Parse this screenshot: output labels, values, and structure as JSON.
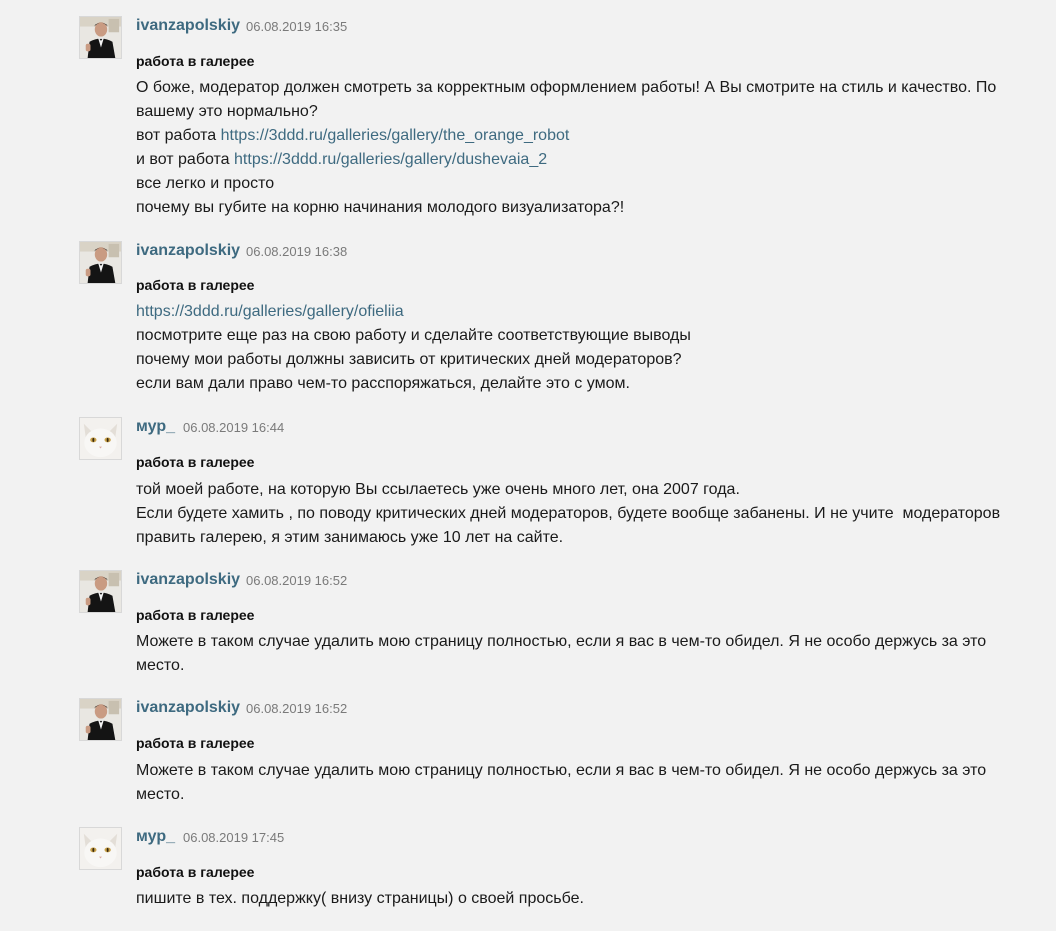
{
  "comments": [
    {
      "author": "ivanzapolskiy",
      "date": "06.08.2019 16:35",
      "subject": "работа в галерее",
      "avatar": "man-in-suit-avatar",
      "lines": [
        {
          "text": "О боже, модератор должен смотреть за корректным оформлением работы! А Вы смотрите на стиль и качество. По"
        },
        {
          "text": "вашему это нормально?"
        },
        {
          "text": "вот работа ",
          "link": "https://3ddd.ru/galleries/gallery/the_orange_robot"
        },
        {
          "text": "и вот работа ",
          "link": "https://3ddd.ru/galleries/gallery/dushevaia_2"
        },
        {
          "text": "все легко и просто"
        },
        {
          "text": "почему вы губите на корню начинания молодого визуализатора?!"
        }
      ]
    },
    {
      "author": "ivanzapolskiy",
      "date": "06.08.2019 16:38",
      "subject": "работа в галерее",
      "avatar": "man-in-suit-avatar",
      "lines": [
        {
          "text": "",
          "link": "https://3ddd.ru/galleries/gallery/ofieliia"
        },
        {
          "text": "посмотрите еще раз на свою работу и сделайте соответствующие выводы"
        },
        {
          "text": "почему мои работы должны зависить от критических дней модераторов?"
        },
        {
          "text": "если вам дали право чем-то расспоряжаться, делайте это с умом."
        }
      ]
    },
    {
      "author": "мур_",
      "date": "06.08.2019 16:44",
      "subject": "работа в галерее",
      "avatar": "white-cat-avatar",
      "lines": [
        {
          "text": "той моей работе, на которую Вы ссылаетесь уже очень много лет, она 2007 года."
        },
        {
          "text": "Если будете хамить , по поводу критических дней модераторов, будете вообще забанены. И не учите  модераторов"
        },
        {
          "text": "править галерею, я этим занимаюсь уже 10 лет на сайте."
        }
      ]
    },
    {
      "author": "ivanzapolskiy",
      "date": "06.08.2019 16:52",
      "subject": "работа в галерее",
      "avatar": "man-in-suit-avatar",
      "lines": [
        {
          "text": "Можете в таком случае удалить мою страницу полностью, если я вас в чем-то обидел. Я не особо держусь за это"
        },
        {
          "text": "место."
        }
      ]
    },
    {
      "author": "ivanzapolskiy",
      "date": "06.08.2019 16:52",
      "subject": "работа в галерее",
      "avatar": "man-in-suit-avatar",
      "lines": [
        {
          "text": "Можете в таком случае удалить мою страницу полностью, если я вас в чем-то обидел. Я не особо держусь за это"
        },
        {
          "text": "место."
        }
      ]
    },
    {
      "author": "мур_",
      "date": "06.08.2019 17:45",
      "subject": "работа в галерее",
      "avatar": "white-cat-avatar",
      "lines": [
        {
          "text": "пишите в тех. поддержку( внизу страницы) о своей просьбе."
        }
      ]
    }
  ]
}
